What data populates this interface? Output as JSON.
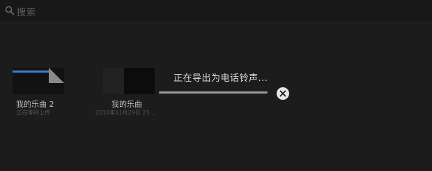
{
  "search": {
    "placeholder": "搜索",
    "icon": "search-icon"
  },
  "songs": [
    {
      "title": "我的乐曲 2",
      "subtitle": "正在等待上传",
      "thumbnail_accent": "#3f7fd0"
    },
    {
      "title": "我的乐曲",
      "subtitle": "2016年11月29日 23..."
    }
  ],
  "export_dialog": {
    "message": "正在导出为电话铃声...",
    "progress": 1.0,
    "cancel_icon": "close-icon"
  },
  "colors": {
    "background": "#1c1c1c",
    "accent": "#3f7fd0"
  }
}
